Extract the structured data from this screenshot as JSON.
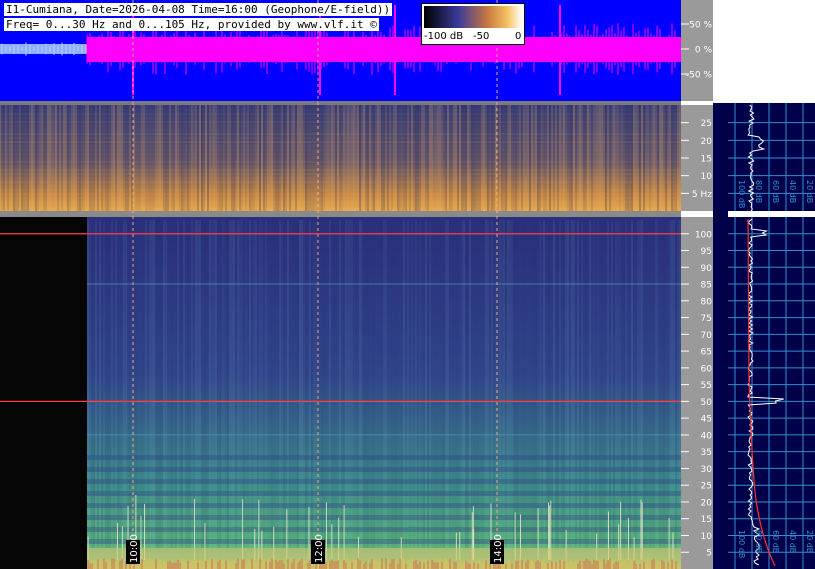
{
  "header": {
    "line1": "I1-Cumiana, Date=2026-04-08 Time=16:00 (Geophone/E-field))",
    "line2": "Freq= 0...30 Hz and 0...105 Hz, provided by www.vlf.it ©"
  },
  "colorbar": {
    "labels": [
      "-100 dB",
      "-50",
      "0"
    ]
  },
  "colors": {
    "waveform_bg": "#0000ff",
    "waveform": "#ff00ff",
    "spectro_low": "#2a2f6e",
    "spectro_high": "#e8a040",
    "axis_panel": "#9a9a9a",
    "profile_bg": "#00004a",
    "profile_grid": "#2f8fd0",
    "marker_line": "#ff4040"
  },
  "chart_data": [
    {
      "type": "line",
      "panel": "waveform",
      "yticks": [
        "50 %",
        "0 %",
        "-50 %"
      ],
      "yvalues": [
        50,
        0,
        -50
      ],
      "unit": "%"
    },
    {
      "type": "heatmap",
      "panel": "spectrogram-0-30Hz",
      "ylim": [
        0,
        30
      ],
      "yticks": [
        "25",
        "20",
        "15",
        "10",
        "5 Hz"
      ],
      "yvalues": [
        25,
        20,
        15,
        10,
        5
      ],
      "profile_ticks": [
        "100 dB",
        "80 dB",
        "60 dB",
        "40 dB",
        "20 dB"
      ]
    },
    {
      "type": "heatmap",
      "panel": "spectrogram-0-105Hz",
      "ylim": [
        0,
        105
      ],
      "yticks": [
        "100",
        "95",
        "90",
        "85",
        "80",
        "75",
        "70",
        "65",
        "60",
        "55",
        "50",
        "45",
        "40",
        "35",
        "30",
        "25",
        "20",
        "15",
        "10",
        "5"
      ],
      "yvalues": [
        100,
        95,
        90,
        85,
        80,
        75,
        70,
        65,
        60,
        55,
        50,
        45,
        40,
        35,
        30,
        25,
        20,
        15,
        10,
        5
      ],
      "lines_hz": [
        100,
        50
      ],
      "time_markers": [
        "10:00",
        "12:00",
        "14:00"
      ],
      "profile_ticks": [
        "100 dB",
        "80 dB",
        "60 dB",
        "40 dB",
        "20 dB"
      ]
    }
  ]
}
